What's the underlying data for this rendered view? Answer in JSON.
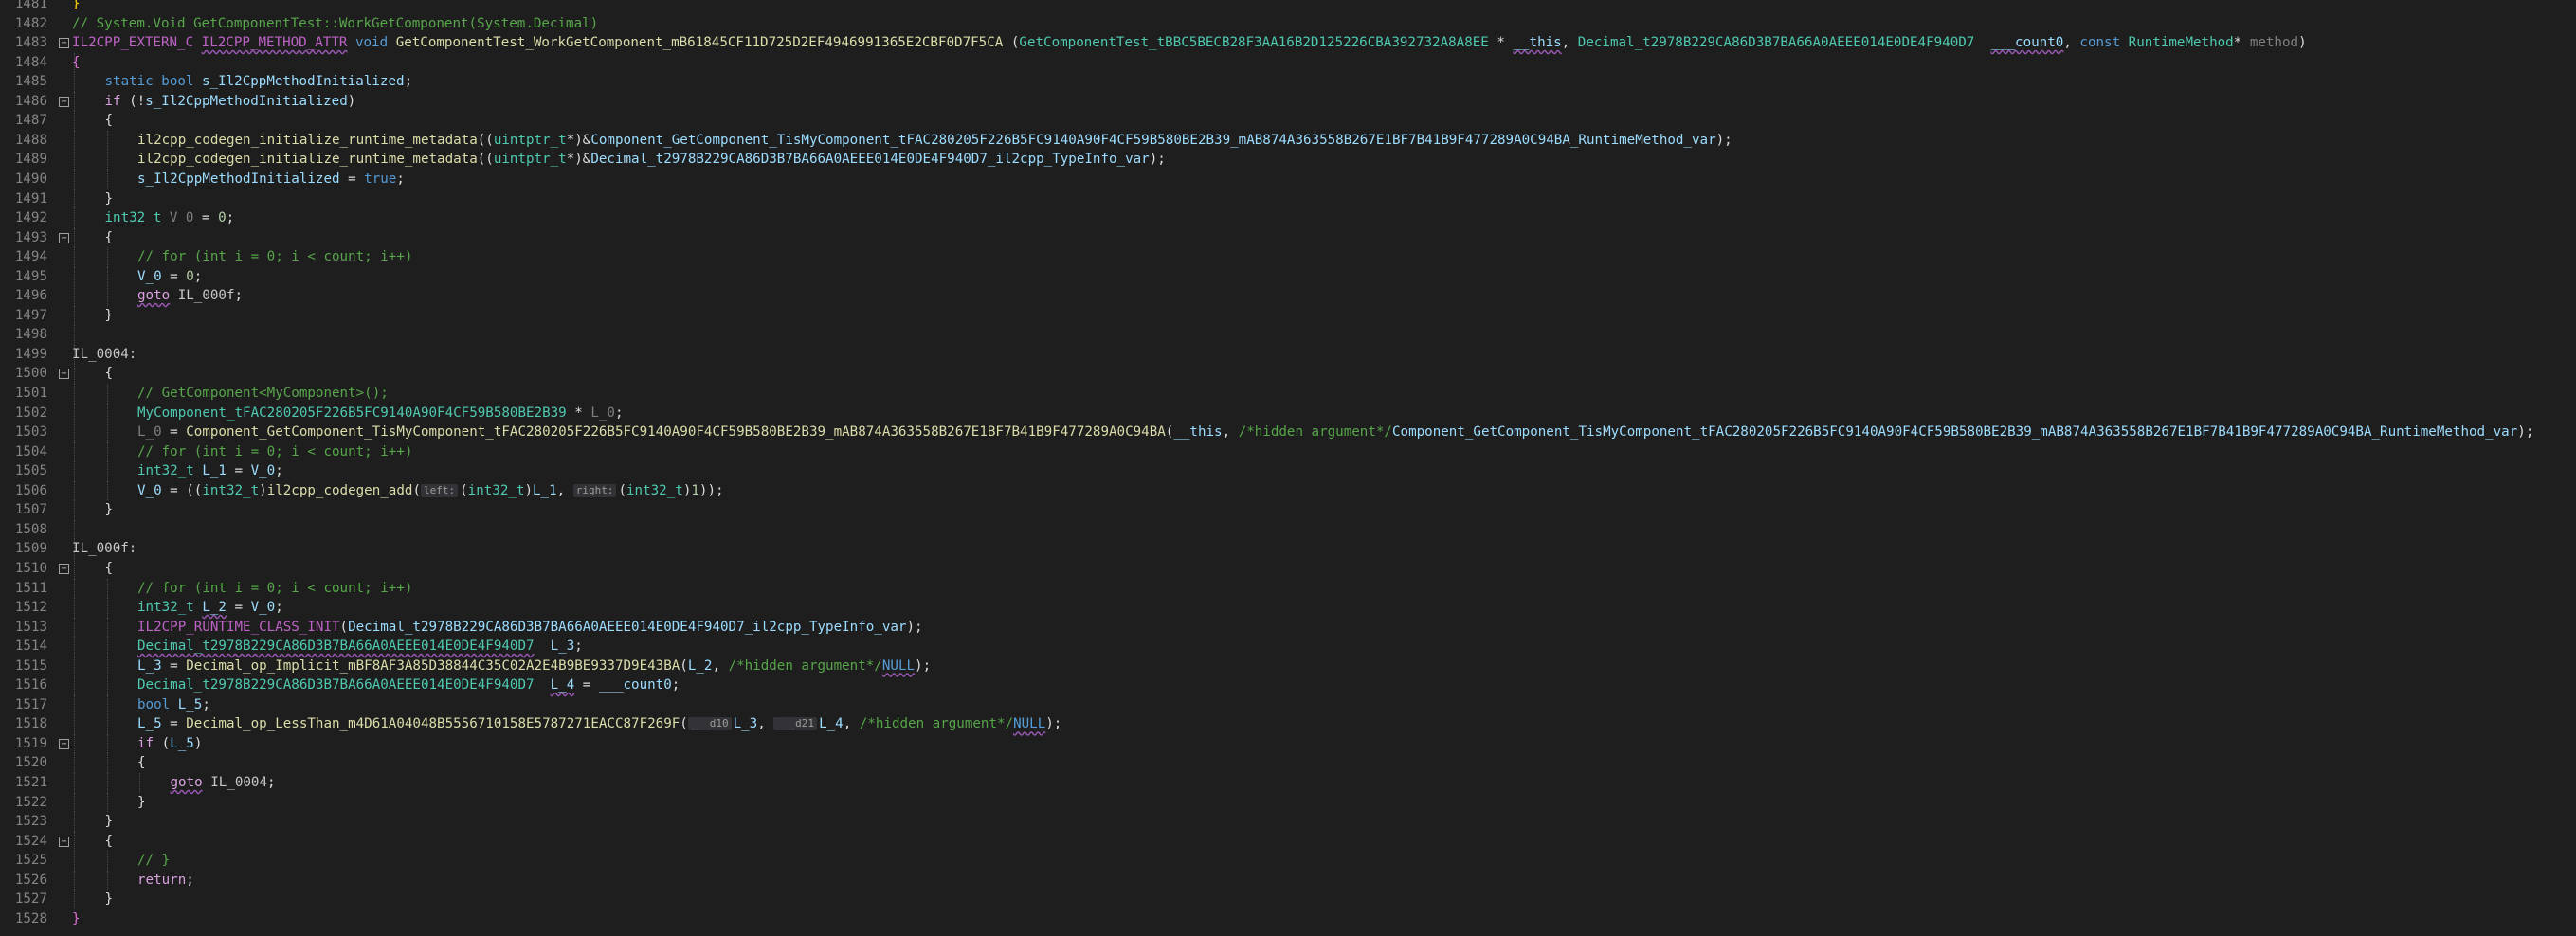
{
  "editor": {
    "language": "cpp",
    "first_line": 1481,
    "lines": [
      {
        "n": "1481",
        "fold": "",
        "indent": 0,
        "html": "<span class=\"br\">}</span>"
      },
      {
        "n": "1482",
        "fold": "",
        "indent": 0,
        "html": "<span class=\"c\">// System.Void GetComponentTest::WorkGetComponent(System.Decimal)</span>"
      },
      {
        "n": "1483",
        "fold": "-",
        "indent": 0,
        "html": "<span class=\"m\">IL2CPP_EXTERN_C</span> <span class=\"m sq\">IL2CPP_METHOD_ATTR</span> <span class=\"k\">void</span> <span class=\"f\">GetComponentTest_WorkGetComponent_mB61845CF11D725D2EF4946991365E2CBF0D7F5CA</span> (<span class=\"t\">GetComponentTest_tBBC5BECB28F3AA16B2D125226CBA392732A8A8EE</span> * <span class=\"p sq\">__this</span>, <span class=\"t\">Decimal_t2978B229CA86D3B7BA66A0AEEE014E0DE4F940D7</span>  <span class=\"p sq\">___count0</span>, <span class=\"k\">const</span> <span class=\"t\">RuntimeMethod</span>* <span class=\"pg\">method</span>)"
      },
      {
        "n": "1484",
        "fold": "",
        "indent": 0,
        "html": "<span class=\"br2\">{</span>"
      },
      {
        "n": "1485",
        "fold": "",
        "indent": 1,
        "html": "<span class=\"k\">static</span> <span class=\"k\">bool</span> <span class=\"p\">s_Il2CppMethodInitialized</span>;"
      },
      {
        "n": "1486",
        "fold": "-",
        "indent": 1,
        "html": "<span class=\"kc\">if</span> (!<span class=\"p\">s_Il2CppMethodInitialized</span>)"
      },
      {
        "n": "1487",
        "fold": "",
        "indent": 1,
        "html": "{"
      },
      {
        "n": "1488",
        "fold": "",
        "indent": 2,
        "html": "<span class=\"f\">il2cpp_codegen_initialize_runtime_metadata</span>((<span class=\"t\">uintptr_t</span>*)&amp;<span class=\"p\">Component_GetComponent_TisMyComponent_tFAC280205F226B5FC9140A90F4CF59B580BE2B39_mAB874A363558B267E1BF7B41B9F477289A0C94BA_RuntimeMethod_var</span>);"
      },
      {
        "n": "1489",
        "fold": "",
        "indent": 2,
        "html": "<span class=\"f\">il2cpp_codegen_initialize_runtime_metadata</span>((<span class=\"t\">uintptr_t</span>*)&amp;<span class=\"p\">Decimal_t2978B229CA86D3B7BA66A0AEEE014E0DE4F940D7_il2cpp_TypeInfo_var</span>);"
      },
      {
        "n": "1490",
        "fold": "",
        "indent": 2,
        "html": "<span class=\"p\">s_Il2CppMethodInitialized</span> = <span class=\"k\">true</span>;"
      },
      {
        "n": "1491",
        "fold": "",
        "indent": 1,
        "html": "}"
      },
      {
        "n": "1492",
        "fold": "",
        "indent": 1,
        "html": "<span class=\"t\">int32_t</span> <span class=\"pg\">V_0</span> = <span class=\"n\">0</span>;"
      },
      {
        "n": "1493",
        "fold": "-",
        "indent": 1,
        "html": "{"
      },
      {
        "n": "1494",
        "fold": "",
        "indent": 2,
        "html": "<span class=\"c\">// for (int i = 0; i &lt; count; i++)</span>"
      },
      {
        "n": "1495",
        "fold": "",
        "indent": 2,
        "html": "<span class=\"p\">V_0</span> = <span class=\"n\">0</span>;"
      },
      {
        "n": "1496",
        "fold": "",
        "indent": 2,
        "html": "<span class=\"kc sq\">goto</span> <span class=\"lb\">IL_000f</span>;"
      },
      {
        "n": "1497",
        "fold": "",
        "indent": 1,
        "html": "}"
      },
      {
        "n": "1498",
        "fold": "",
        "indent": 0,
        "html": ""
      },
      {
        "n": "1499",
        "fold": "",
        "indent": 0,
        "html": "<span class=\"lb\">IL_0004:</span>"
      },
      {
        "n": "1500",
        "fold": "-",
        "indent": 1,
        "html": "{"
      },
      {
        "n": "1501",
        "fold": "",
        "indent": 2,
        "html": "<span class=\"c\">// GetComponent&lt;MyComponent&gt;();</span>"
      },
      {
        "n": "1502",
        "fold": "",
        "indent": 2,
        "html": "<span class=\"t\">MyComponent_tFAC280205F226B5FC9140A90F4CF59B580BE2B39</span> * <span class=\"pg\">L_0</span>;"
      },
      {
        "n": "1503",
        "fold": "",
        "indent": 2,
        "html": "<span class=\"pg\">L_0</span> = <span class=\"f\">Component_GetComponent_TisMyComponent_tFAC280205F226B5FC9140A90F4CF59B580BE2B39_mAB874A363558B267E1BF7B41B9F477289A0C94BA</span>(<span class=\"p\">__this</span>, <span class=\"c\">/*hidden argument*/</span><span class=\"p\">Component_GetComponent_TisMyComponent_tFAC280205F226B5FC9140A90F4CF59B580BE2B39_mAB874A363558B267E1BF7B41B9F477289A0C94BA_RuntimeMethod_var</span>);"
      },
      {
        "n": "1504",
        "fold": "",
        "indent": 2,
        "html": "<span class=\"c\">// for (int i = 0; i &lt; count; i++)</span>"
      },
      {
        "n": "1505",
        "fold": "",
        "indent": 2,
        "html": "<span class=\"t\">int32_t</span> <span class=\"p\">L_1</span> = <span class=\"p\">V_0</span>;"
      },
      {
        "n": "1506",
        "fold": "",
        "indent": 2,
        "html": "<span class=\"p\">V_0</span> = ((<span class=\"t\">int32_t</span>)<span class=\"f\">il2cpp_codegen_add</span>(<span class=\"hint\">left:</span>(<span class=\"t\">int32_t</span>)<span class=\"p\">L_1</span>, <span class=\"hint\">right:</span>(<span class=\"t\">int32_t</span>)<span class=\"n\">1</span>));"
      },
      {
        "n": "1507",
        "fold": "",
        "indent": 1,
        "html": "}"
      },
      {
        "n": "1508",
        "fold": "",
        "indent": 0,
        "html": ""
      },
      {
        "n": "1509",
        "fold": "",
        "indent": 0,
        "html": "<span class=\"lb\">IL_000f:</span>"
      },
      {
        "n": "1510",
        "fold": "-",
        "indent": 1,
        "html": "{"
      },
      {
        "n": "1511",
        "fold": "",
        "indent": 2,
        "html": "<span class=\"c\">// for (int i = 0; i &lt; count; i++)</span>"
      },
      {
        "n": "1512",
        "fold": "",
        "indent": 2,
        "html": "<span class=\"t\">int32_t</span> <span class=\"p sq\">L_2</span> = <span class=\"p\">V_0</span>;"
      },
      {
        "n": "1513",
        "fold": "",
        "indent": 2,
        "html": "<span class=\"m\">IL2CPP_RUNTIME_CLASS_INIT</span>(<span class=\"p\">Decimal_t2978B229CA86D3B7BA66A0AEEE014E0DE4F940D7_il2cpp_TypeInfo_var</span>);"
      },
      {
        "n": "1514",
        "fold": "",
        "indent": 2,
        "html": "<span class=\"t sq\">Decimal_t2978B229CA86D3B7BA66A0AEEE014E0DE4F940D7</span>  <span class=\"p\">L_3</span>;"
      },
      {
        "n": "1515",
        "fold": "",
        "indent": 2,
        "html": "<span class=\"p\">L_3</span> = <span class=\"f\">Decimal_op_Implicit_mBF8AF3A85D38844C35C02A2E4B9BE9337D9E43BA</span>(<span class=\"p\">L_2</span>, <span class=\"c\">/*hidden argument*/</span><span class=\"k sq\">NULL</span>);"
      },
      {
        "n": "1516",
        "fold": "",
        "indent": 2,
        "html": "<span class=\"t\">Decimal_t2978B229CA86D3B7BA66A0AEEE014E0DE4F940D7</span>  <span class=\"p sq\">L_4</span> = <span class=\"p\">___count0</span>;"
      },
      {
        "n": "1517",
        "fold": "",
        "indent": 2,
        "html": "<span class=\"k\">bool</span> <span class=\"p\">L_5</span>;"
      },
      {
        "n": "1518",
        "fold": "",
        "indent": 2,
        "html": "<span class=\"p\">L_5</span> = <span class=\"f\">Decimal_op_LessThan_m4D61A04048B5556710158E5787271EACC87F269F</span>(<span class=\"hint\">___d10</span><span class=\"p\">L_3</span>, <span class=\"hint\">___d21</span><span class=\"p\">L_4</span>, <span class=\"c\">/*hidden argument*/</span><span class=\"k sq\">NULL</span>);"
      },
      {
        "n": "1519",
        "fold": "-",
        "indent": 2,
        "html": "<span class=\"kc\">if</span> (<span class=\"p\">L_5</span>)"
      },
      {
        "n": "1520",
        "fold": "",
        "indent": 2,
        "html": "{"
      },
      {
        "n": "1521",
        "fold": "",
        "indent": 3,
        "html": "<span class=\"kc sq\">goto</span> <span class=\"lb\">IL_0004</span>;"
      },
      {
        "n": "1522",
        "fold": "",
        "indent": 2,
        "html": "}"
      },
      {
        "n": "1523",
        "fold": "",
        "indent": 1,
        "html": "}"
      },
      {
        "n": "1524",
        "fold": "-",
        "indent": 1,
        "html": "{"
      },
      {
        "n": "1525",
        "fold": "",
        "indent": 2,
        "html": "<span class=\"c\">// }</span>"
      },
      {
        "n": "1526",
        "fold": "",
        "indent": 2,
        "html": "<span class=\"kc\">return</span>;"
      },
      {
        "n": "1527",
        "fold": "",
        "indent": 1,
        "html": "}"
      },
      {
        "n": "1528",
        "fold": "",
        "indent": 0,
        "html": "<span class=\"br2\">}</span>"
      }
    ]
  }
}
